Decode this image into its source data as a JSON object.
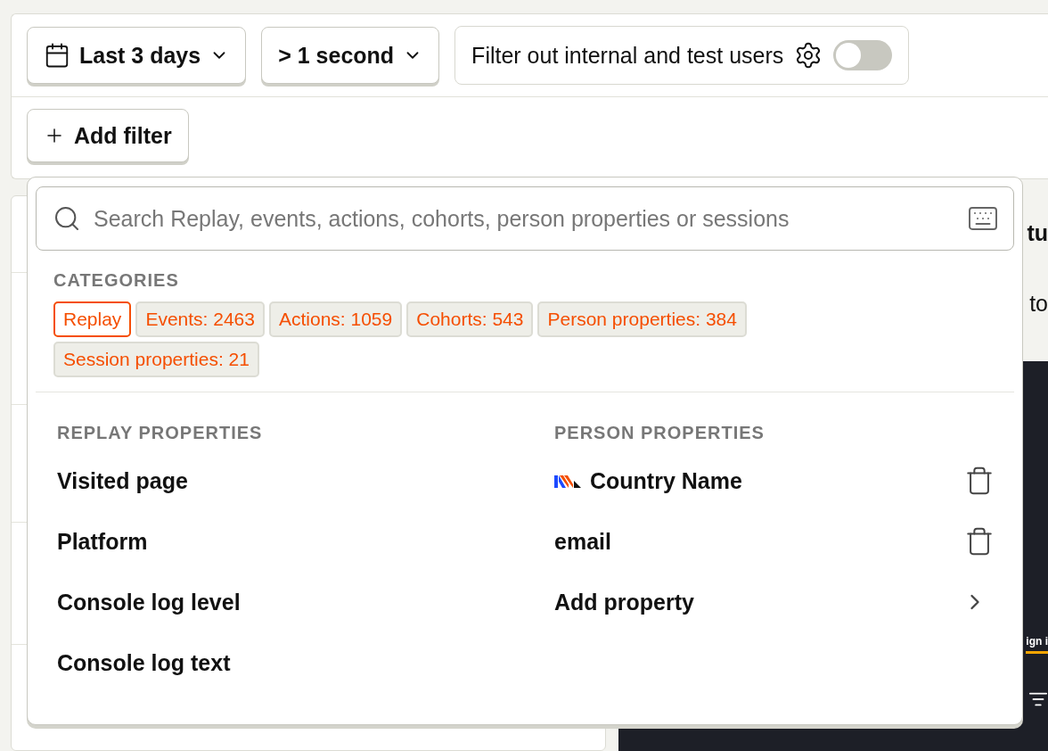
{
  "filters": {
    "date_range": "Last 3 days",
    "duration": "> 1 second",
    "internal_users": {
      "label": "Filter out internal and test users",
      "on": false
    },
    "add_filter": "Add filter"
  },
  "background": {
    "heading_fragment": "tu",
    "text_fragment": "to",
    "button_fragment": "ign i"
  },
  "dropdown": {
    "search": {
      "placeholder": "Search Replay, events, actions, cohorts, person properties or sessions"
    },
    "categories_title": "CATEGORIES",
    "categories": [
      {
        "label": "Replay",
        "selected": true
      },
      {
        "label": "Events: 2463",
        "selected": false
      },
      {
        "label": "Actions: 1059",
        "selected": false
      },
      {
        "label": "Cohorts: 543",
        "selected": false
      },
      {
        "label": "Person properties: 384",
        "selected": false
      },
      {
        "label": "Session properties: 21",
        "selected": false
      }
    ],
    "replay_properties": {
      "title": "REPLAY PROPERTIES",
      "items": [
        "Visited page",
        "Platform",
        "Console log level",
        "Console log text"
      ]
    },
    "person_properties": {
      "title": "PERSON PROPERTIES",
      "items": [
        {
          "label": "Country Name",
          "kind": "pinned",
          "logo": true
        },
        {
          "label": "email",
          "kind": "pinned",
          "logo": false
        },
        {
          "label": "Add property",
          "kind": "submenu",
          "logo": false
        }
      ]
    }
  }
}
